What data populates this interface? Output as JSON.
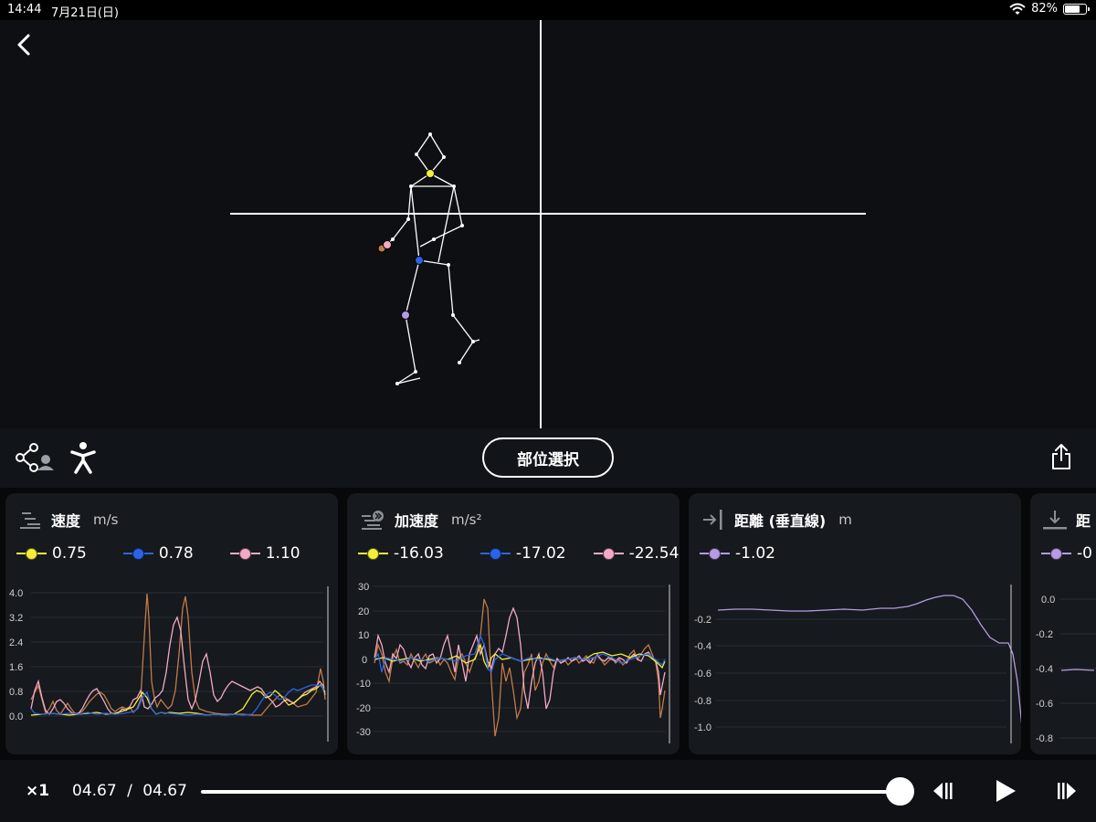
{
  "status_bar": {
    "time": "14:44",
    "date": "7月21日(日)",
    "battery": "82%",
    "battery_level": 0.82
  },
  "toolbar": {
    "select_label": "部位選択"
  },
  "colors": {
    "yellow": "#f3ee3a",
    "blue": "#2a63e8",
    "pink": "#f3a9c6",
    "purple": "#b69ae6",
    "brown": "#c07b4a"
  },
  "panels": [
    {
      "title": "速度",
      "unit": "m/s",
      "icon": "velocity-icon",
      "legend": [
        {
          "value": "0.75",
          "color": "#f3ee3a"
        },
        {
          "value": "0.78",
          "color": "#2a63e8"
        },
        {
          "value": "1.10",
          "color": "#f3a9c6"
        }
      ],
      "yticks": [
        "4.0",
        "3.2",
        "2.4",
        "1.6",
        "0.8",
        "0.0"
      ]
    },
    {
      "title": "加速度",
      "unit": "m/s²",
      "icon": "acceleration-icon",
      "legend": [
        {
          "value": "-16.03",
          "color": "#f3ee3a"
        },
        {
          "value": "-17.02",
          "color": "#2a63e8"
        },
        {
          "value": "-22.54",
          "color": "#f3a9c6"
        }
      ],
      "yticks": [
        "30",
        "20",
        "10",
        "0",
        "-10",
        "-20",
        "-30"
      ]
    },
    {
      "title": "距離 (垂直線)",
      "unit": "m",
      "icon": "distance-horizontal-icon",
      "legend": [
        {
          "value": "-1.02",
          "color": "#b69ae6"
        }
      ],
      "yticks": [
        "-0.2",
        "-0.4",
        "-0.6",
        "-0.8",
        "-1.0"
      ]
    },
    {
      "title": "距",
      "unit": "",
      "icon": "distance-vertical-icon",
      "legend": [
        {
          "value": "-0",
          "color": "#b69ae6"
        }
      ],
      "yticks": [
        "0.0",
        "-0.2",
        "-0.4",
        "-0.6",
        "-0.8"
      ]
    }
  ],
  "playback": {
    "speed": "×1",
    "current": "04.67",
    "separator": "/",
    "total": "04.67",
    "progress": 1.0
  }
}
